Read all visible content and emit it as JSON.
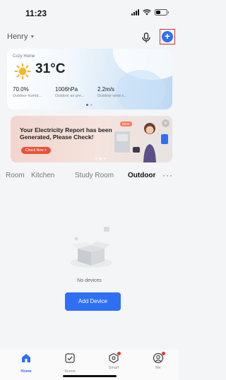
{
  "status_bar": {
    "time": "11:23"
  },
  "header": {
    "home_name": "Henry"
  },
  "weather": {
    "title": "Cozy Home",
    "temperature": "31°C",
    "stats": [
      {
        "value": "70.0%",
        "label": "Outdoor humid..."
      },
      {
        "value": "1006hPa",
        "label": "Outdoor air pre..."
      },
      {
        "value": "2.2m/s",
        "label": "Outdoor wind s..."
      }
    ]
  },
  "banner": {
    "title": "Your Electricity Report has been Generated, Please Check!",
    "button": "Check Now >",
    "badge": "NEW",
    "close": "×"
  },
  "room_tabs": {
    "items": [
      "Room",
      "Kitchen",
      "Study Room",
      "Outdoor"
    ],
    "active": "Outdoor",
    "more": "···"
  },
  "empty_state": {
    "message": "No devices",
    "button": "Add Device"
  },
  "bottom_nav": {
    "items": [
      {
        "label": "Home",
        "icon": "home-icon",
        "active": true
      },
      {
        "label": "Scene",
        "icon": "scene-icon",
        "active": false
      },
      {
        "label": "Smart",
        "icon": "smart-icon",
        "active": false,
        "badge": true
      },
      {
        "label": "Me",
        "icon": "profile-icon",
        "active": false,
        "badge": true
      }
    ]
  },
  "colors": {
    "accent": "#2e6ff3",
    "highlight_box": "#d93025",
    "banner_button": "#e8543b",
    "badge_dot": "#e8392b"
  }
}
